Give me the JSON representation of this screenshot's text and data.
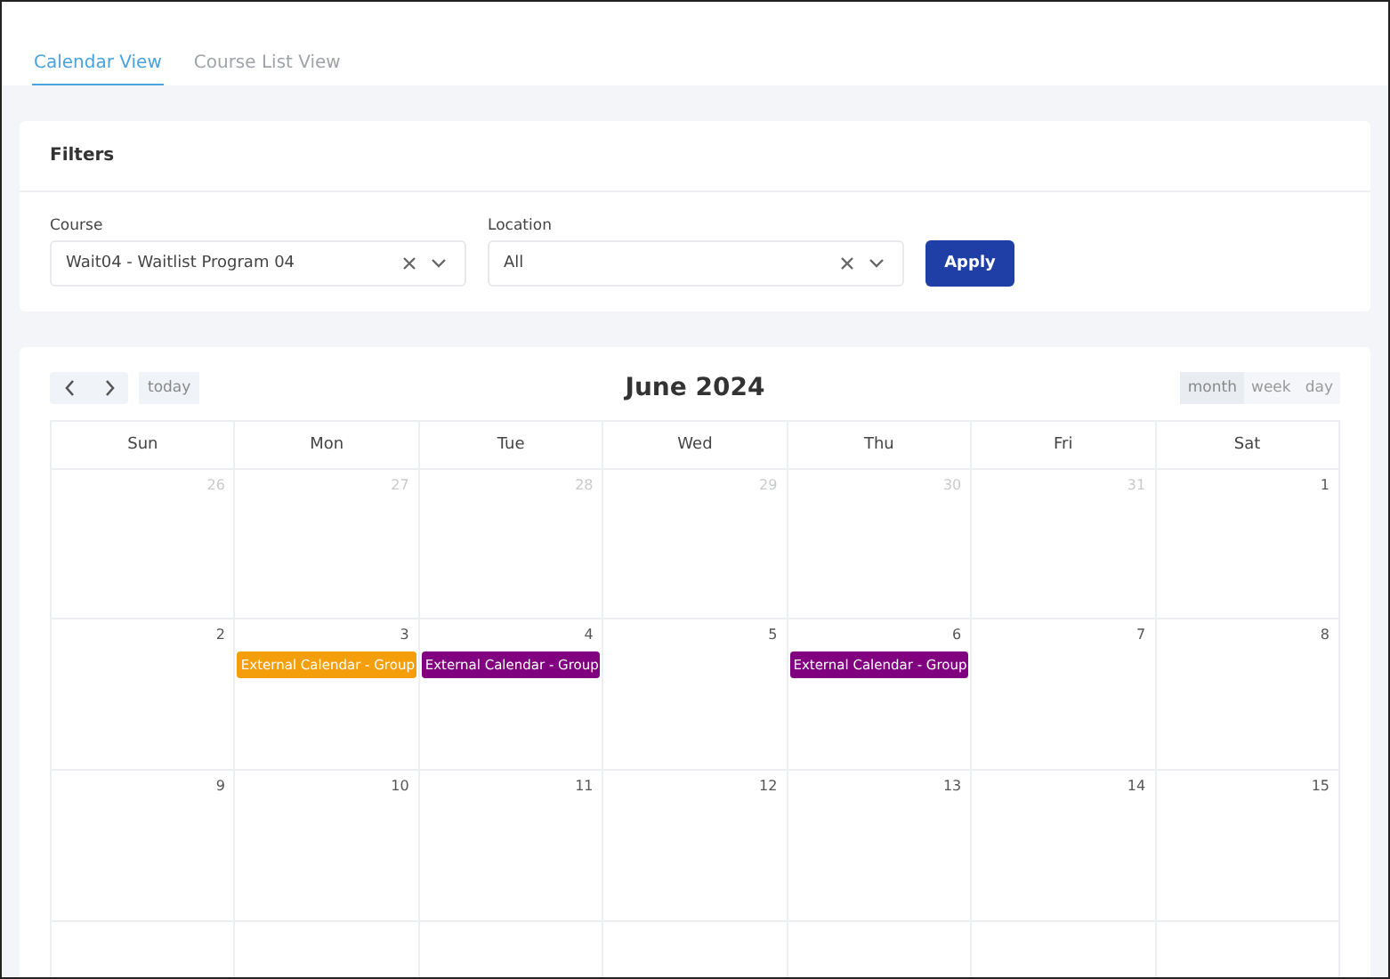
{
  "tabs": [
    {
      "label": "Calendar View",
      "selected": true
    },
    {
      "label": "Course List View",
      "selected": false
    }
  ],
  "filters": {
    "title": "Filters",
    "fields": [
      {
        "label": "Course",
        "value": "Wait04 - Waitlist Program 04"
      },
      {
        "label": "Location",
        "value": "All"
      }
    ],
    "apply_button": "Apply"
  },
  "calendar": {
    "title": "June 2024",
    "today_button": "today",
    "views": [
      {
        "label": "month",
        "selected": true
      },
      {
        "label": "week",
        "selected": false
      },
      {
        "label": "day",
        "selected": false
      }
    ],
    "weekdays": [
      "Sun",
      "Mon",
      "Tue",
      "Wed",
      "Thu",
      "Fri",
      "Sat"
    ],
    "weeks": [
      [
        {
          "day": "26",
          "muted": true
        },
        {
          "day": "27",
          "muted": true
        },
        {
          "day": "28",
          "muted": true
        },
        {
          "day": "29",
          "muted": true
        },
        {
          "day": "30",
          "muted": true
        },
        {
          "day": "31",
          "muted": true
        },
        {
          "day": "1",
          "muted": false
        }
      ],
      [
        {
          "day": "2",
          "muted": false
        },
        {
          "day": "3",
          "muted": false,
          "events": [
            {
              "title": "External Calendar - Group",
              "color": "#f59e0b"
            }
          ]
        },
        {
          "day": "4",
          "muted": false,
          "events": [
            {
              "title": "External Calendar - Group",
              "color": "#800080"
            }
          ]
        },
        {
          "day": "5",
          "muted": false
        },
        {
          "day": "6",
          "muted": false,
          "events": [
            {
              "title": "External Calendar - Group",
              "color": "#800080"
            }
          ]
        },
        {
          "day": "7",
          "muted": false
        },
        {
          "day": "8",
          "muted": false
        }
      ],
      [
        {
          "day": "9",
          "muted": false
        },
        {
          "day": "10",
          "muted": false
        },
        {
          "day": "11",
          "muted": false
        },
        {
          "day": "12",
          "muted": false
        },
        {
          "day": "13",
          "muted": false
        },
        {
          "day": "14",
          "muted": false
        },
        {
          "day": "15",
          "muted": false
        }
      ]
    ]
  }
}
